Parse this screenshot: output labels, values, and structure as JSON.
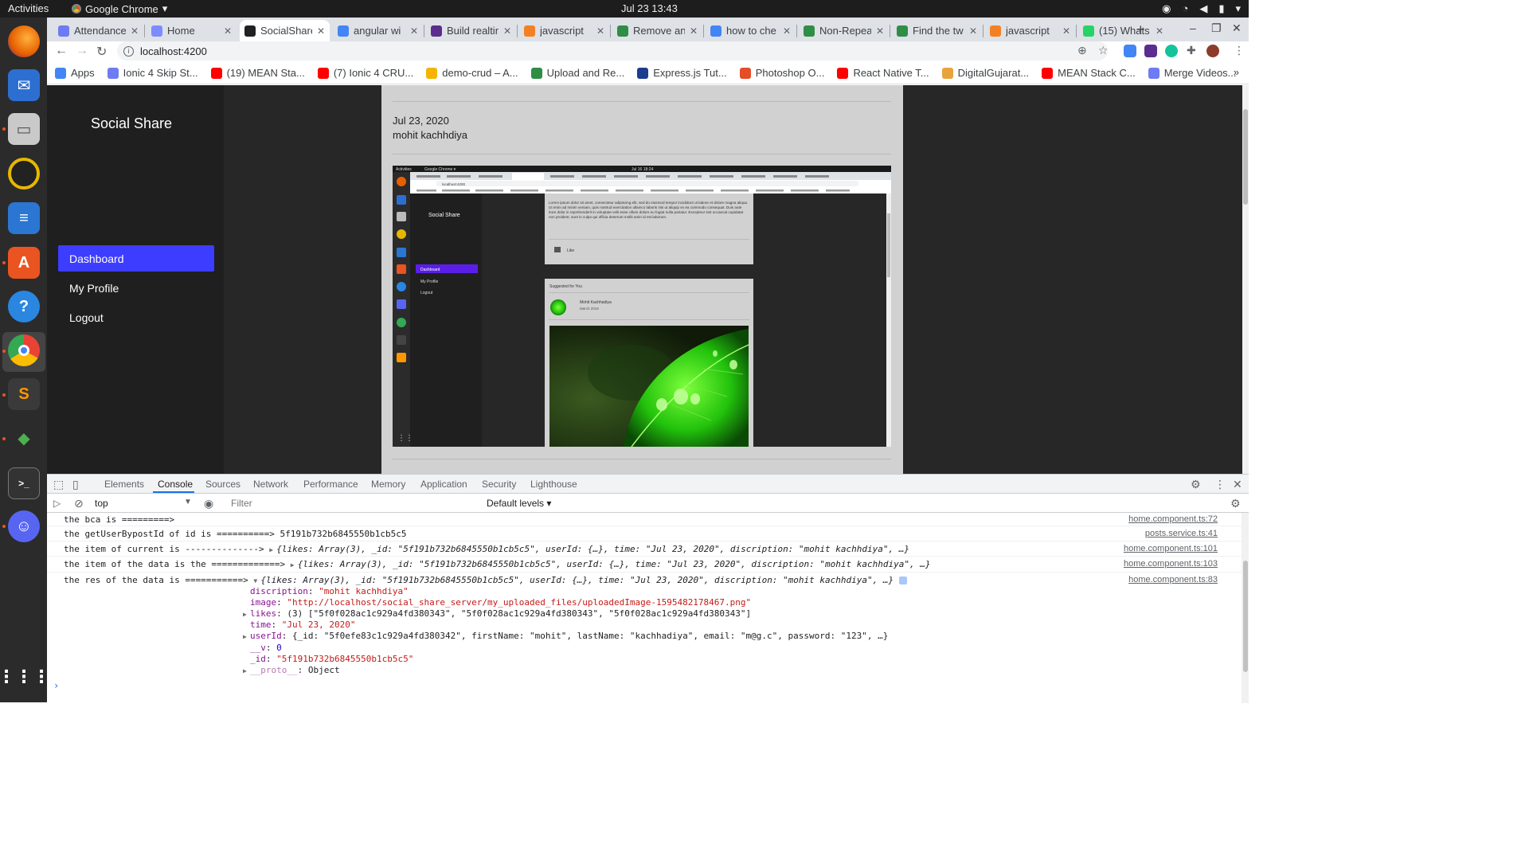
{
  "os": {
    "activities": "Activities",
    "app_menu": "Google Chrome",
    "clock": "Jul 23  13:43"
  },
  "browser": {
    "tabs": [
      {
        "label": "Attendance",
        "color": "#6e7bf2"
      },
      {
        "label": "Home",
        "color": "#7c8cff"
      },
      {
        "label": "SocialShare",
        "color": "#202124"
      },
      {
        "label": "angular wi",
        "color": "#4285f4"
      },
      {
        "label": "Build realtime",
        "color": "#5b2d8e"
      },
      {
        "label": "javascript",
        "color": "#f48024"
      },
      {
        "label": "Remove an",
        "color": "#2f8d46"
      },
      {
        "label": "how to che",
        "color": "#4285f4"
      },
      {
        "label": "Non-Repea",
        "color": "#2f8d46"
      },
      {
        "label": "Find the tw",
        "color": "#2f8d46"
      },
      {
        "label": "javascript",
        "color": "#f48024"
      },
      {
        "label": "(15) Whats",
        "color": "#25d366"
      }
    ],
    "url": "localhost:4200",
    "bookmarks": [
      {
        "label": "Apps",
        "color": "#4285f4"
      },
      {
        "label": "Ionic 4 Skip St...",
        "color": "#6e7bf2"
      },
      {
        "label": "(19) MEAN Sta...",
        "color": "#ff0000"
      },
      {
        "label": "(7) Ionic 4 CRU...",
        "color": "#ff0000"
      },
      {
        "label": "demo-crud – A...",
        "color": "#f4b400"
      },
      {
        "label": "Upload and Re...",
        "color": "#2f8d46"
      },
      {
        "label": "Express.js Tut...",
        "color": "#1a3d8f"
      },
      {
        "label": "Photoshop O...",
        "color": "#e44d26"
      },
      {
        "label": "React Native T...",
        "color": "#ff0000"
      },
      {
        "label": "DigitalGujarat...",
        "color": "#e8a33d"
      },
      {
        "label": "MEAN Stack C...",
        "color": "#ff0000"
      },
      {
        "label": "Merge Videos...",
        "color": "#6e7bf2"
      }
    ]
  },
  "app": {
    "brand": "Social Share",
    "nav": [
      "Dashboard",
      "My Profile",
      "Logout"
    ],
    "accent": "#3d3dff",
    "post": {
      "date": "Jul 23, 2020",
      "author": "mohit kachhdiya"
    },
    "nested_screenshot": {
      "clock": "Jul 16  18:24",
      "url": "localhost:4200",
      "brand": "Social Share",
      "nav": [
        "Dashboard",
        "My Profile",
        "Logout"
      ],
      "lorem": "Lorem ipsum dolor sit amet, consectetur adipiscing elit, sed do eiusmod tempor incididunt ut labore et dolore magna aliqua. Ut enim ad minim veniam, quis nostrud exercitation ullamco laboris nisi ut aliquip ex ea commodo consequat. Duis aute irure dolor in reprehenderit in voluptate velit esse cillum dolore eu fugiat nulla pariatur. Excepteur sint occaecat cupidatat non proident, sunt in culpa qui officia deserunt mollit anim id est laborum.",
      "like": "Like",
      "suggested": "Suggested for You",
      "sugg_name": "Mohit Kachhadiya",
      "sugg_date": "March 2019"
    }
  },
  "devtools": {
    "tabs": [
      "Elements",
      "Console",
      "Sources",
      "Network",
      "Performance",
      "Memory",
      "Application",
      "Security",
      "Lighthouse"
    ],
    "context": "top",
    "filter_placeholder": "Filter",
    "levels": "Default levels",
    "logs": [
      {
        "msg": "the bca is =========>",
        "src": "home.component.ts:72"
      },
      {
        "msg": "the getUserBypostId of id is ==========> 5f191b732b6845550b1cb5c5",
        "src": "posts.service.ts:41"
      },
      {
        "prefix": "the item of current is -------------->",
        "summary": "{likes: Array(3), _id: \"5f191b732b6845550b1cb5c5\", userId: {…}, time: \"Jul 23, 2020\", discription: \"mohit kachhdiya\", …}",
        "src": "home.component.ts:101"
      },
      {
        "prefix": "the item of the data is the =============>",
        "summary": "{likes: Array(3), _id: \"5f191b732b6845550b1cb5c5\", userId: {…}, time: \"Jul 23, 2020\", discription: \"mohit kachhdiya\", …}",
        "src": "home.component.ts:103"
      },
      {
        "prefix": "the res of the data is ===========>",
        "summary": "{likes: Array(3), _id: \"5f191b732b6845550b1cb5c5\", userId: {…}, time: \"Jul 23, 2020\", discription: \"mohit kachhdiya\", …}",
        "src": "home.component.ts:83"
      }
    ],
    "expanded": {
      "discription": "\"mohit kachhdiya\"",
      "image": "\"http://localhost/social_share_server/my_uploaded_files/uploadedImage-1595482178467.png\"",
      "likes": "(3) [\"5f0f028ac1c929a4fd380343\", \"5f0f028ac1c929a4fd380343\", \"5f0f028ac1c929a4fd380343\"]",
      "time": "\"Jul 23, 2020\"",
      "userId": "{_id: \"5f0efe83c1c929a4fd380342\", firstName: \"mohit\", lastName: \"kachhadiya\", email: \"m@g.c\", password: \"123\", …}",
      "__v": "0",
      "_id": "\"5f191b732b6845550b1cb5c5\"",
      "__proto__": "Object"
    }
  }
}
